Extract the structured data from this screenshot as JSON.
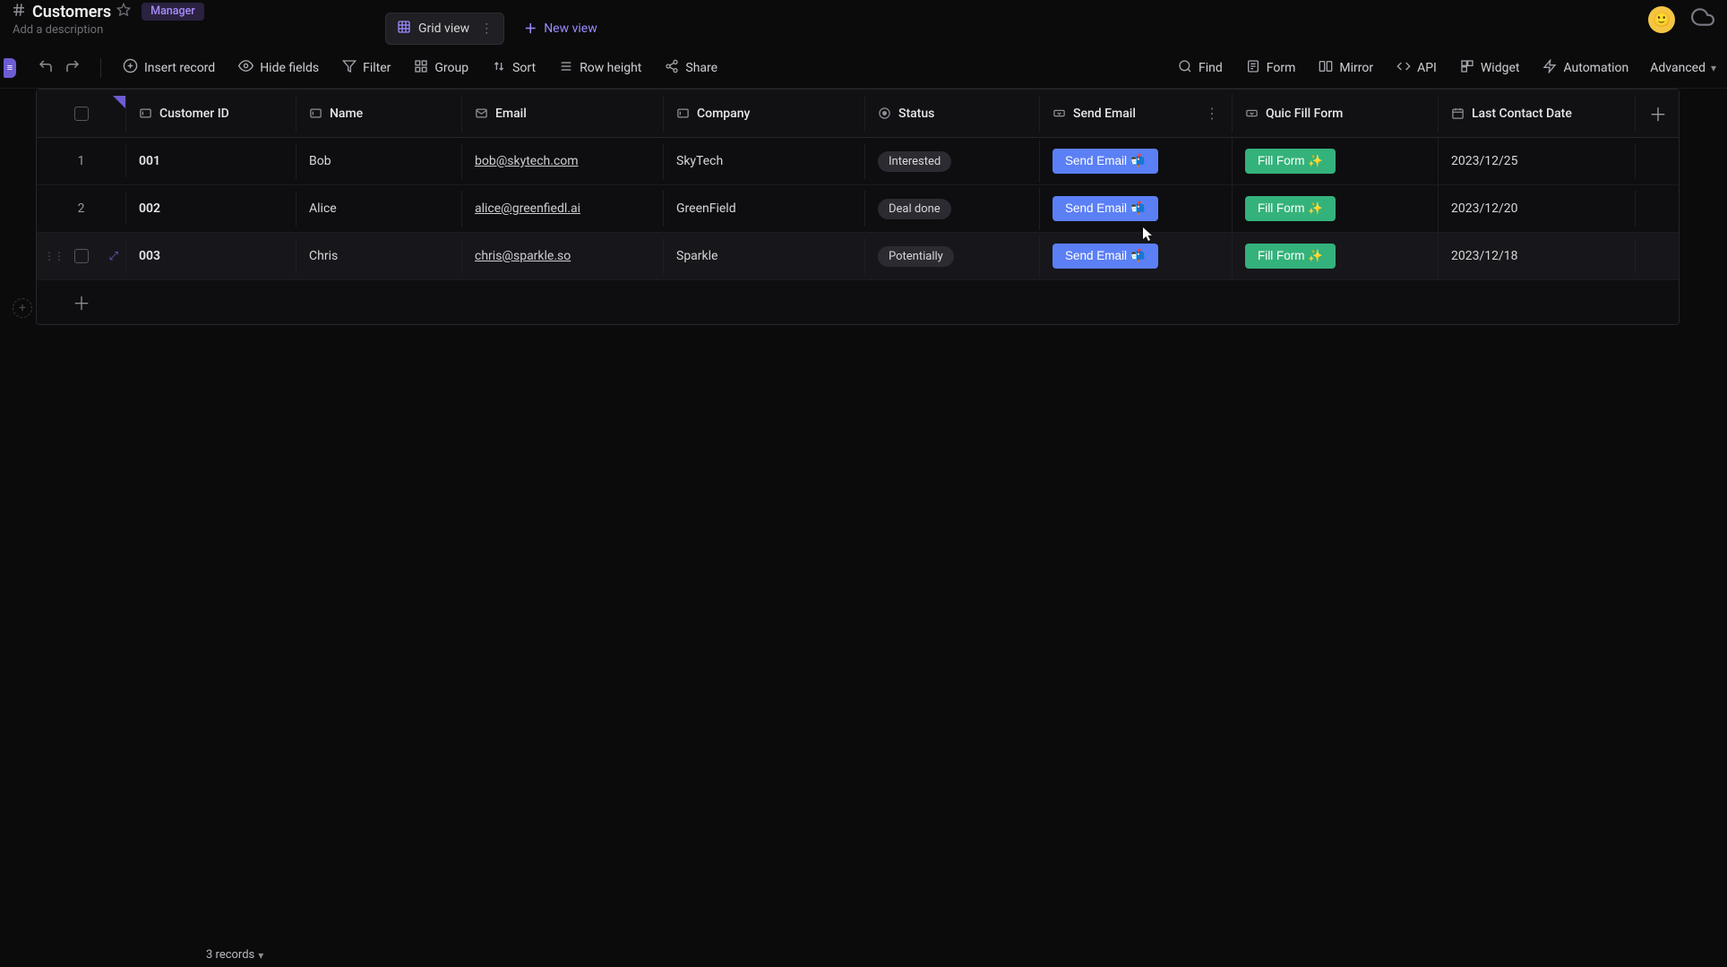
{
  "header": {
    "title": "Customers",
    "role_badge": "Manager",
    "description_placeholder": "Add a description"
  },
  "views": {
    "active_view": "Grid view",
    "new_view_label": "New view"
  },
  "toolbar": {
    "insert_record": "Insert record",
    "hide_fields": "Hide fields",
    "filter": "Filter",
    "group": "Group",
    "sort": "Sort",
    "row_height": "Row height",
    "share": "Share",
    "find": "Find",
    "form": "Form",
    "mirror": "Mirror",
    "api": "API",
    "widget": "Widget",
    "automation": "Automation",
    "advanced": "Advanced"
  },
  "columns": {
    "customer_id": "Customer ID",
    "name": "Name",
    "email": "Email",
    "company": "Company",
    "status": "Status",
    "send_email": "Send Email",
    "quick_fill_form": "Quic Fill Form",
    "last_contact": "Last Contact Date"
  },
  "buttons": {
    "send_email_label": "Send Email 📬",
    "fill_form_label": "Fill Form ✨"
  },
  "rows": [
    {
      "num": "1",
      "customer_id": "001",
      "name": "Bob",
      "email": "bob@skytech.com",
      "company": "SkyTech",
      "status": "Interested",
      "last_contact": "2023/12/25"
    },
    {
      "num": "2",
      "customer_id": "002",
      "name": "Alice",
      "email": "alice@greenfiedl.ai",
      "company": "GreenField",
      "status": "Deal done",
      "last_contact": "2023/12/20"
    },
    {
      "num": "",
      "customer_id": "003",
      "name": "Chris",
      "email": "chris@sparkle.so",
      "company": "Sparkle",
      "status": "Potentially",
      "last_contact": "2023/12/18"
    }
  ],
  "footer": {
    "record_count": "3 records"
  }
}
